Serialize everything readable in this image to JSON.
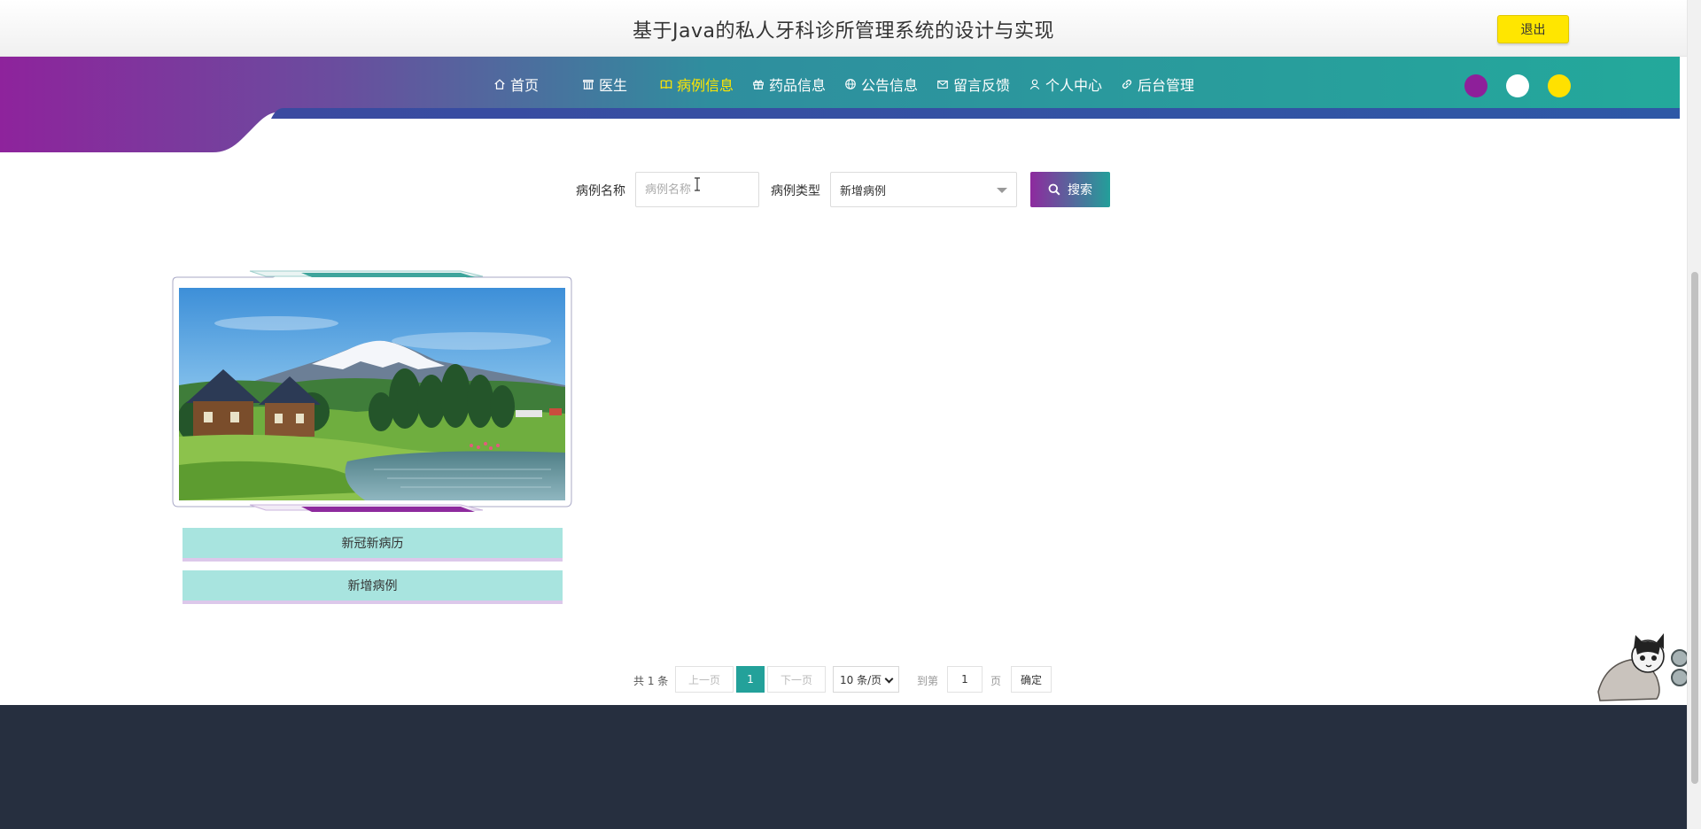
{
  "header": {
    "title": "基于Java的私人牙科诊所管理系统的设计与实现",
    "logout_label": "退出"
  },
  "nav": {
    "items": [
      {
        "label": "首页",
        "icon": "home-icon"
      },
      {
        "label": "医生",
        "icon": "building-icon"
      },
      {
        "label": "病例信息",
        "icon": "book-icon",
        "active": true
      },
      {
        "label": "药品信息",
        "icon": "gift-icon"
      },
      {
        "label": "公告信息",
        "icon": "globe-icon"
      },
      {
        "label": "留言反馈",
        "icon": "mail-icon"
      },
      {
        "label": "个人中心",
        "icon": "user-icon"
      },
      {
        "label": "后台管理",
        "icon": "link-icon"
      }
    ],
    "theme_colors": [
      "#8e1f9a",
      "#ffffff",
      "#ffe100"
    ],
    "accent_teal": "#23a99b",
    "accent_purple": "#8e2a9e"
  },
  "search": {
    "name_label": "病例名称",
    "name_placeholder": "病例名称",
    "name_value": "",
    "type_label": "病例类型",
    "type_selected": "新增病例",
    "button_label": "搜索"
  },
  "cards": [
    {
      "image": "landscape-photo",
      "tags": [
        "新冠新病历",
        "新增病例"
      ]
    }
  ],
  "pagination": {
    "total_text": "共 1 条",
    "prev_label": "上一页",
    "current_page": "1",
    "next_label": "下一页",
    "page_size_selected": "10 条/页",
    "goto_label": "到第",
    "goto_value": "1",
    "page_unit": "页",
    "confirm_label": "确定"
  }
}
